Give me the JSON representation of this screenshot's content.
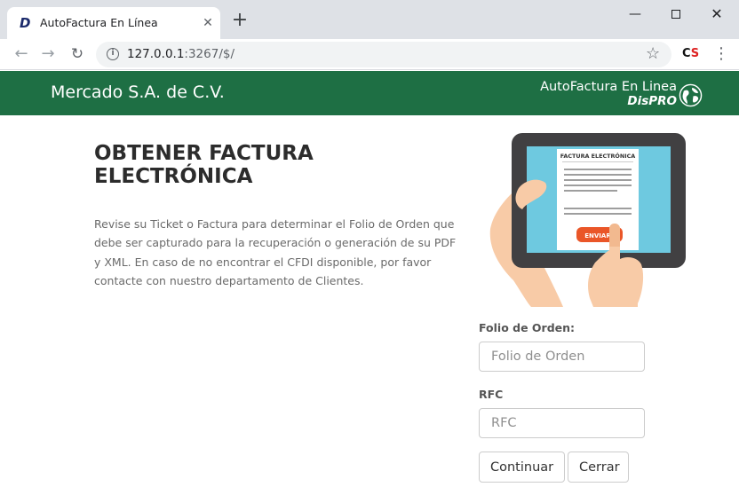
{
  "browser": {
    "tab_title": "AutoFactura En Línea",
    "tab_favicon": "D",
    "tab_close": "✕",
    "new_tab": "+",
    "url_host": "127.0.0.1",
    "url_rest": ":3267/$/",
    "window_controls": {
      "minimize": "—",
      "close": "✕"
    },
    "icons": [
      "back-arrow-icon",
      "forward-arrow-icon",
      "reload-icon",
      "info-icon",
      "star-icon",
      "extension-icon",
      "menu-icon"
    ],
    "extension_label_c": "C",
    "extension_label_s": "S"
  },
  "header": {
    "brand": "Mercado S.A. de C.V.",
    "logo_line1": "AutoFactura En Linea",
    "logo_line2": "DisPRO",
    "color": "#1e6f44"
  },
  "main": {
    "title": "OBTENER FACTURA ELECTRÓNICA",
    "intro": "Revise su Ticket o Factura para determinar el Folio de Orden que debe ser capturado para la recuperación o generación de su PDF y XML. En caso de no encontrar el CFDI disponible, por favor contacte con nuestro departamento de Clientes.",
    "illustration": {
      "doc_title": "FACTURA ELECTRÓNICA",
      "button_label": "ENVIAR"
    }
  },
  "form": {
    "folio_label": "Folio de Orden:",
    "folio_value": "",
    "folio_placeholder": "Folio de Orden",
    "rfc_label": "RFC",
    "rfc_value": "",
    "rfc_placeholder": "RFC",
    "continue_label": "Continuar",
    "close_label": "Cerrar"
  }
}
